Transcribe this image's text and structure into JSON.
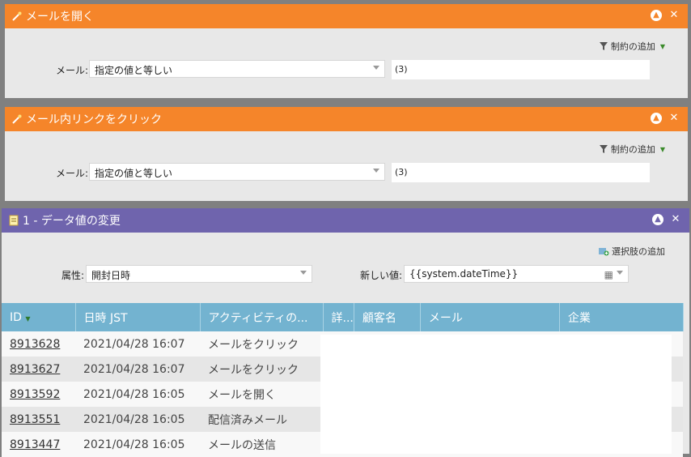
{
  "panel1": {
    "title": "メールを開く",
    "add_constraint": "制約の追加",
    "field_label": "メール:",
    "operator": "指定の値と等しい",
    "value": "(3)"
  },
  "panel2": {
    "title": "メール内リンクをクリック",
    "add_constraint": "制約の追加",
    "field_label": "メール:",
    "operator": "指定の値と等しい",
    "value": "(3)"
  },
  "panel3": {
    "title": "1 - データ値の変更",
    "add_choice": "選択肢の追加",
    "attr_label": "属性:",
    "attr_value": "開封日時",
    "new_value_label": "新しい値:",
    "new_value": "{{system.dateTime}}"
  },
  "table": {
    "columns": [
      "ID",
      "日時 JST",
      "アクティビティの...",
      "詳...",
      "顧客名",
      "メール",
      "企業"
    ],
    "rows": [
      {
        "id": "8913628",
        "datetime": "2021/04/28 16:07",
        "activity": "メールをクリック"
      },
      {
        "id": "8913627",
        "datetime": "2021/04/28 16:07",
        "activity": "メールをクリック"
      },
      {
        "id": "8913592",
        "datetime": "2021/04/28 16:05",
        "activity": "メールを開く"
      },
      {
        "id": "8913551",
        "datetime": "2021/04/28 16:05",
        "activity": "配信済みメール"
      },
      {
        "id": "8913447",
        "datetime": "2021/04/28 16:05",
        "activity": "メールの送信"
      }
    ]
  },
  "colors": {
    "orange": "#f5852a",
    "purple": "#6f64ad",
    "grid_header": "#73b3d0"
  }
}
